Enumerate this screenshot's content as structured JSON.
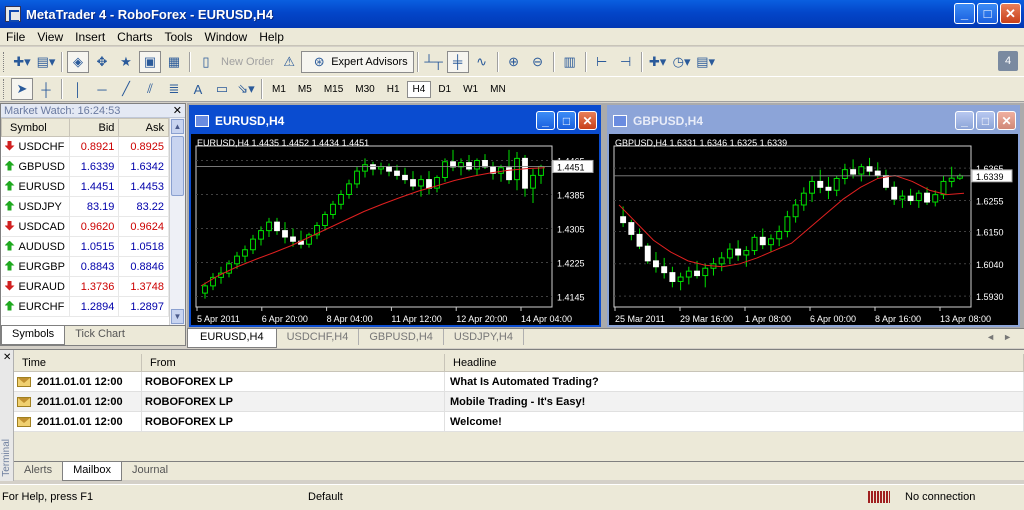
{
  "window": {
    "title": "MetaTrader 4 - RoboForex - EURUSD,H4"
  },
  "menu": [
    "File",
    "View",
    "Insert",
    "Charts",
    "Tools",
    "Window",
    "Help"
  ],
  "toolbar": {
    "new_order": "New Order",
    "expert_advisors": "Expert Advisors",
    "notification_count": "4"
  },
  "timeframes": [
    "M1",
    "M5",
    "M15",
    "M30",
    "H1",
    "H4",
    "D1",
    "W1",
    "MN"
  ],
  "active_timeframe": "H4",
  "market_watch": {
    "title": "Market Watch: 16:24:53",
    "headers": {
      "symbol": "Symbol",
      "bid": "Bid",
      "ask": "Ask"
    },
    "rows": [
      {
        "symbol": "USDCHF",
        "bid": "0.8921",
        "ask": "0.8925",
        "dir": "down"
      },
      {
        "symbol": "GBPUSD",
        "bid": "1.6339",
        "ask": "1.6342",
        "dir": "up"
      },
      {
        "symbol": "EURUSD",
        "bid": "1.4451",
        "ask": "1.4453",
        "dir": "up"
      },
      {
        "symbol": "USDJPY",
        "bid": "83.19",
        "ask": "83.22",
        "dir": "up"
      },
      {
        "symbol": "USDCAD",
        "bid": "0.9620",
        "ask": "0.9624",
        "dir": "down"
      },
      {
        "symbol": "AUDUSD",
        "bid": "1.0515",
        "ask": "1.0518",
        "dir": "up"
      },
      {
        "symbol": "EURGBP",
        "bid": "0.8843",
        "ask": "0.8846",
        "dir": "up"
      },
      {
        "symbol": "EURAUD",
        "bid": "1.3736",
        "ask": "1.3748",
        "dir": "down"
      },
      {
        "symbol": "EURCHF",
        "bid": "1.2894",
        "ask": "1.2897",
        "dir": "up"
      }
    ],
    "tabs": [
      "Symbols",
      "Tick Chart"
    ]
  },
  "charts": [
    {
      "window_title": "EURUSD,H4",
      "info": "EURUSD,H4  1.4435 1.4452 1.4434 1.4451",
      "price_labels": [
        "1.4465",
        "1.4385",
        "1.4305",
        "1.4225",
        "1.4145"
      ],
      "price_values": [
        1.4465,
        1.4385,
        1.4305,
        1.4225,
        1.4145
      ],
      "ylim": [
        1.4125,
        1.4485
      ],
      "current_price": "1.4451",
      "current_value": 1.4451,
      "time_labels": [
        "5 Apr 2011",
        "6 Apr 20:00",
        "8 Apr 04:00",
        "11 Apr 12:00",
        "12 Apr 20:00",
        "14 Apr 04:00"
      ],
      "candles": [
        [
          1.4153,
          1.4178,
          1.414,
          1.417
        ],
        [
          1.417,
          1.42,
          1.416,
          1.419
        ],
        [
          1.419,
          1.4215,
          1.4175,
          1.42
        ],
        [
          1.42,
          1.423,
          1.419,
          1.4222
        ],
        [
          1.4222,
          1.425,
          1.421,
          1.424
        ],
        [
          1.424,
          1.4265,
          1.4225,
          1.4255
        ],
        [
          1.4255,
          1.429,
          1.4245,
          1.428
        ],
        [
          1.428,
          1.431,
          1.4265,
          1.43
        ],
        [
          1.43,
          1.433,
          1.4285,
          1.432
        ],
        [
          1.432,
          1.433,
          1.429,
          1.43
        ],
        [
          1.43,
          1.432,
          1.427,
          1.4285
        ],
        [
          1.4285,
          1.4305,
          1.4262,
          1.4275
        ],
        [
          1.4275,
          1.43,
          1.4258,
          1.4268
        ],
        [
          1.4268,
          1.4295,
          1.426,
          1.429
        ],
        [
          1.429,
          1.432,
          1.428,
          1.4312
        ],
        [
          1.4312,
          1.4345,
          1.43,
          1.4338
        ],
        [
          1.4338,
          1.437,
          1.4328,
          1.4362
        ],
        [
          1.4362,
          1.4395,
          1.435,
          1.4385
        ],
        [
          1.4385,
          1.442,
          1.4375,
          1.441
        ],
        [
          1.441,
          1.445,
          1.44,
          1.444
        ],
        [
          1.444,
          1.447,
          1.4425,
          1.4455
        ],
        [
          1.4455,
          1.4462,
          1.443,
          1.4445
        ],
        [
          1.4445,
          1.446,
          1.4432,
          1.445
        ],
        [
          1.445,
          1.4458,
          1.4428,
          1.444
        ],
        [
          1.444,
          1.4455,
          1.442,
          1.443
        ],
        [
          1.443,
          1.4448,
          1.441,
          1.442
        ],
        [
          1.442,
          1.444,
          1.4395,
          1.4405
        ],
        [
          1.4405,
          1.443,
          1.438,
          1.442
        ],
        [
          1.442,
          1.444,
          1.4385,
          1.44
        ],
        [
          1.44,
          1.443,
          1.439,
          1.4425
        ],
        [
          1.4425,
          1.447,
          1.4415,
          1.4462
        ],
        [
          1.4462,
          1.449,
          1.444,
          1.445
        ],
        [
          1.445,
          1.447,
          1.443,
          1.446
        ],
        [
          1.446,
          1.4478,
          1.444,
          1.4445
        ],
        [
          1.4445,
          1.447,
          1.443,
          1.4465
        ],
        [
          1.4465,
          1.448,
          1.4445,
          1.445
        ],
        [
          1.445,
          1.4462,
          1.442,
          1.4435
        ],
        [
          1.4435,
          1.4455,
          1.4415,
          1.4448
        ],
        [
          1.4448,
          1.449,
          1.441,
          1.442
        ],
        [
          1.442,
          1.4485,
          1.4395,
          1.447
        ],
        [
          1.447,
          1.4478,
          1.438,
          1.44
        ],
        [
          1.44,
          1.4445,
          1.4365,
          1.443
        ],
        [
          1.443,
          1.4455,
          1.441,
          1.4451
        ]
      ],
      "ma": [
        1.417,
        1.4195,
        1.4215,
        1.4232,
        1.4248,
        1.4265,
        1.4285,
        1.4305,
        1.4325,
        1.4345,
        1.4362,
        1.4378,
        1.4393,
        1.4405,
        1.4418,
        1.4428,
        1.4436,
        1.4442,
        1.4446,
        1.4448
      ]
    },
    {
      "window_title": "GBPUSD,H4",
      "info": "GBPUSD,H4  1.6331 1.6346 1.6325 1.6339",
      "price_labels": [
        "1.6365",
        "1.6255",
        "1.6150",
        "1.6040",
        "1.5930"
      ],
      "price_values": [
        1.6365,
        1.6255,
        1.615,
        1.604,
        1.593
      ],
      "ylim": [
        1.59,
        1.642
      ],
      "current_price": "1.6339",
      "current_value": 1.6339,
      "time_labels": [
        "25 Mar 2011",
        "29 Mar 16:00",
        "1 Apr 08:00",
        "6 Apr 00:00",
        "8 Apr 16:00",
        "13 Apr 08:00"
      ],
      "candles": [
        [
          1.62,
          1.6235,
          1.6165,
          1.618
        ],
        [
          1.618,
          1.619,
          1.612,
          1.614
        ],
        [
          1.614,
          1.616,
          1.609,
          1.61
        ],
        [
          1.61,
          1.611,
          1.604,
          1.605
        ],
        [
          1.605,
          1.608,
          1.601,
          1.603
        ],
        [
          1.603,
          1.606,
          1.599,
          1.601
        ],
        [
          1.601,
          1.603,
          1.596,
          1.598
        ],
        [
          1.598,
          1.601,
          1.595,
          1.5995
        ],
        [
          1.5995,
          1.603,
          1.597,
          1.6015
        ],
        [
          1.6015,
          1.605,
          1.599,
          1.6
        ],
        [
          1.6,
          1.604,
          1.596,
          1.6025
        ],
        [
          1.6025,
          1.606,
          1.6,
          1.604
        ],
        [
          1.604,
          1.608,
          1.6015,
          1.606
        ],
        [
          1.606,
          1.611,
          1.604,
          1.609
        ],
        [
          1.609,
          1.612,
          1.605,
          1.607
        ],
        [
          1.607,
          1.61,
          1.603,
          1.6085
        ],
        [
          1.6085,
          1.614,
          1.607,
          1.613
        ],
        [
          1.613,
          1.616,
          1.609,
          1.6105
        ],
        [
          1.6105,
          1.614,
          1.608,
          1.6125
        ],
        [
          1.6125,
          1.617,
          1.61,
          1.615
        ],
        [
          1.615,
          1.622,
          1.613,
          1.62
        ],
        [
          1.62,
          1.626,
          1.618,
          1.624
        ],
        [
          1.624,
          1.63,
          1.622,
          1.628
        ],
        [
          1.628,
          1.634,
          1.625,
          1.632
        ],
        [
          1.632,
          1.636,
          1.628,
          1.63
        ],
        [
          1.63,
          1.6335,
          1.626,
          1.629
        ],
        [
          1.629,
          1.634,
          1.627,
          1.633
        ],
        [
          1.633,
          1.638,
          1.631,
          1.636
        ],
        [
          1.636,
          1.6395,
          1.633,
          1.6345
        ],
        [
          1.6345,
          1.638,
          1.632,
          1.637
        ],
        [
          1.637,
          1.64,
          1.634,
          1.6355
        ],
        [
          1.6355,
          1.6385,
          1.633,
          1.634
        ],
        [
          1.634,
          1.636,
          1.629,
          1.63
        ],
        [
          1.63,
          1.632,
          1.624,
          1.626
        ],
        [
          1.626,
          1.629,
          1.623,
          1.627
        ],
        [
          1.627,
          1.6295,
          1.624,
          1.6255
        ],
        [
          1.6255,
          1.629,
          1.623,
          1.628
        ],
        [
          1.628,
          1.63,
          1.624,
          1.625
        ],
        [
          1.625,
          1.629,
          1.6235,
          1.6275
        ],
        [
          1.6275,
          1.634,
          1.626,
          1.632
        ],
        [
          1.632,
          1.637,
          1.63,
          1.6331
        ],
        [
          1.6331,
          1.6346,
          1.6325,
          1.6339
        ]
      ],
      "ma": [
        1.624,
        1.618,
        1.612,
        1.608,
        1.605,
        1.6035,
        1.603,
        1.604,
        1.606,
        1.6085,
        1.611,
        1.616,
        1.621,
        1.626,
        1.63,
        1.633,
        1.634,
        1.632,
        1.629,
        1.6275,
        1.628
      ]
    }
  ],
  "chart_tabs": [
    "EURUSD,H4",
    "USDCHF,H4",
    "GBPUSD,H4",
    "USDJPY,H4"
  ],
  "terminal": {
    "label": "Terminal",
    "headers": {
      "time": "Time",
      "from": "From",
      "headline": "Headline"
    },
    "rows": [
      {
        "time": "2011.01.01 12:00",
        "from": "ROBOFOREX LP",
        "headline": "What Is Automated Trading?"
      },
      {
        "time": "2011.01.01 12:00",
        "from": "ROBOFOREX LP",
        "headline": "Mobile Trading - It's Easy!"
      },
      {
        "time": "2011.01.01 12:00",
        "from": "ROBOFOREX LP",
        "headline": "Welcome!"
      }
    ],
    "tabs": [
      "Alerts",
      "Mailbox",
      "Journal"
    ]
  },
  "status": {
    "help": "For Help, press F1",
    "profile": "Default",
    "connection": "No connection"
  },
  "colors": {
    "bull": "#00e000",
    "bear": "#00e000",
    "ma": "#e02020",
    "grid": "#404040",
    "up_arrow": "#1fa91f",
    "down_arrow": "#d02020"
  }
}
